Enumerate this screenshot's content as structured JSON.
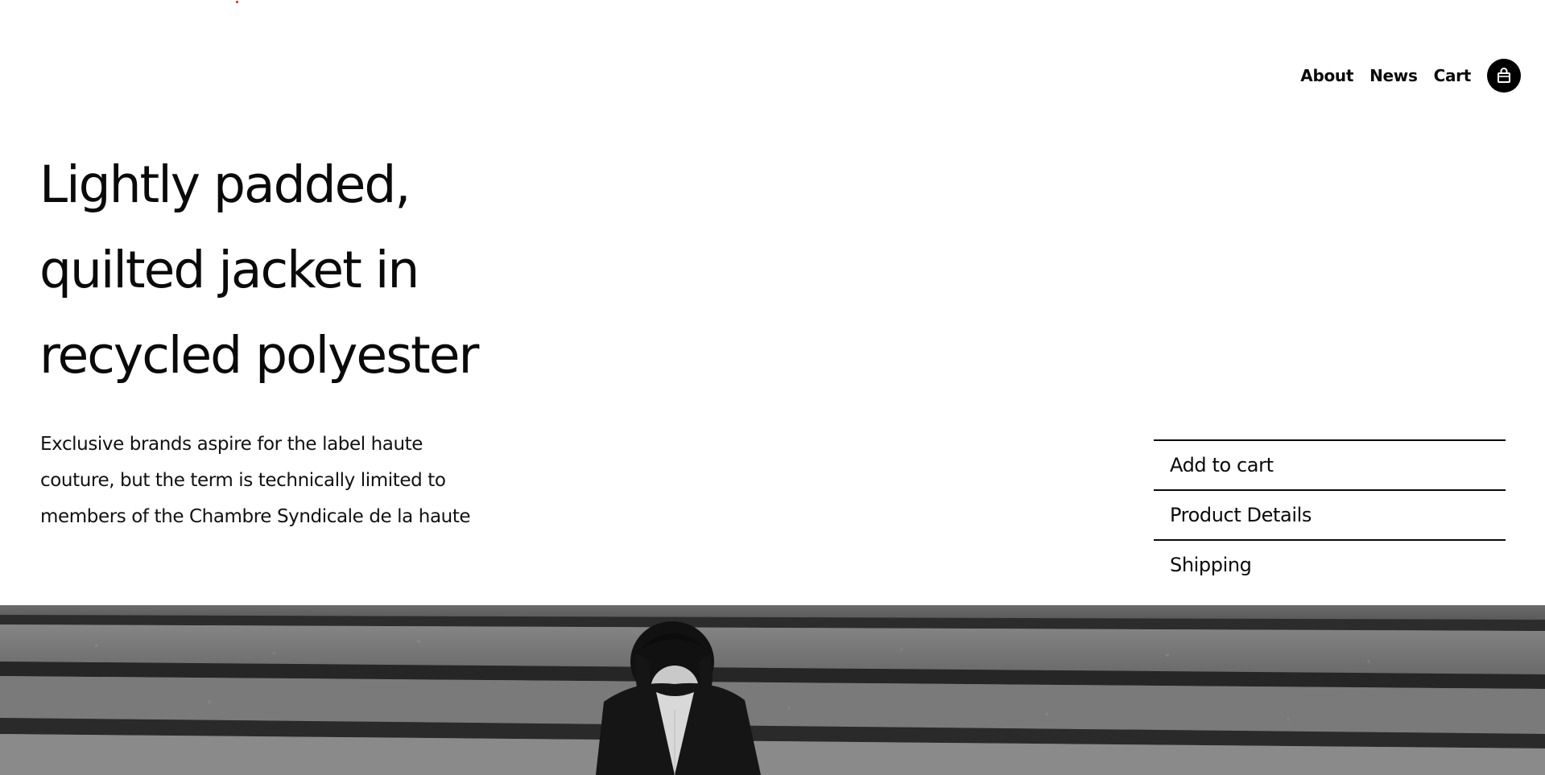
{
  "nav": {
    "about": "About",
    "news": "News",
    "cart": "Cart",
    "cart_icon": "shopping-bag-icon"
  },
  "product": {
    "title_lines": [
      "Lightly padded,",
      "quilted jacket in",
      "recycled polyester"
    ],
    "description_lines": [
      "Exclusive brands aspire for the label haute",
      "couture, but the term is technically limited to",
      "members of the Chambre Syndicale de la haute"
    ]
  },
  "actions": {
    "add_to_cart": "Add to cart",
    "product_details": "Product Details",
    "shipping": "Shipping"
  },
  "hero": {
    "description_icon": "black-and-white-photo-of-person-on-stairs"
  },
  "colors": {
    "text": "#0a0a0a",
    "background": "#ffffff",
    "accent_dot": "#e0201b"
  }
}
